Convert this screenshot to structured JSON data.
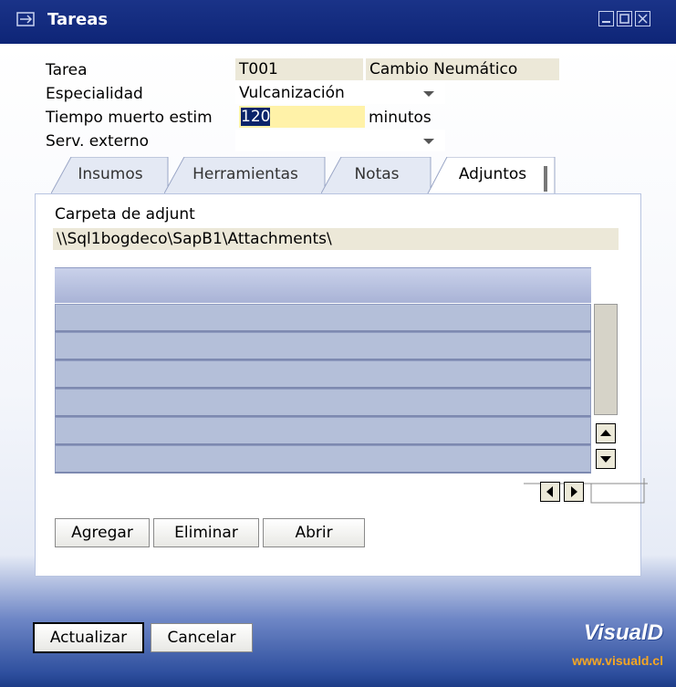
{
  "window": {
    "title": "Tareas"
  },
  "form": {
    "tarea_label": "Tarea",
    "tarea_code": "T001",
    "tarea_desc": "Cambio Neumático",
    "especialidad_label": "Especialidad",
    "especialidad_value": "Vulcanización",
    "tiempo_label": "Tiempo muerto estim",
    "tiempo_value": "120",
    "tiempo_unit": "minutos",
    "serv_label": "Serv. externo",
    "serv_value": ""
  },
  "tabs": [
    {
      "label": "Insumos"
    },
    {
      "label": "Herramientas"
    },
    {
      "label": "Notas"
    },
    {
      "label": "Adjuntos"
    }
  ],
  "attachments": {
    "folder_label": "Carpeta de adjunt",
    "folder_path": "\\\\Sql1bogdeco\\SapB1\\Attachments\\"
  },
  "panel_buttons": {
    "add": "Agregar",
    "delete": "Eliminar",
    "open": "Abrir"
  },
  "footer": {
    "update": "Actualizar",
    "cancel": "Cancelar"
  },
  "brand": {
    "name": "VisualD",
    "url": "www.visuald.cl",
    "accent": "#f5a623"
  }
}
